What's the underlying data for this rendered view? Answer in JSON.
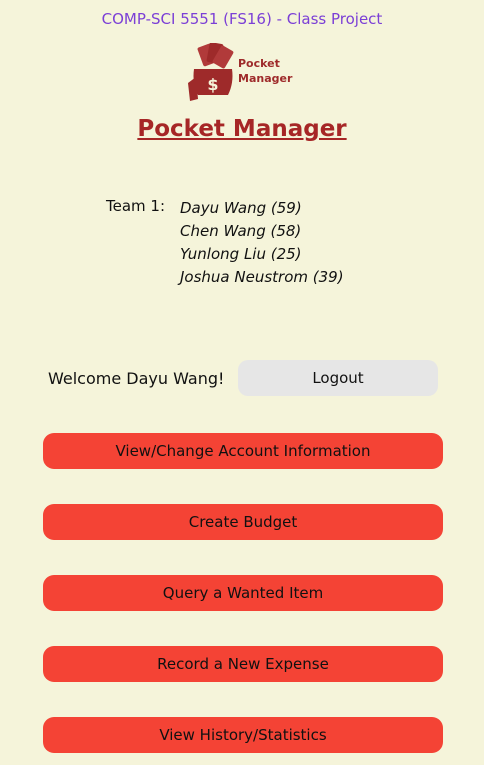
{
  "header": {
    "course": "COMP-SCI 5551 (FS16) - Class Project",
    "logo_line1": "Pocket",
    "logo_line2": "Manager",
    "app_title": "Pocket Manager"
  },
  "team": {
    "label": "Team 1:",
    "members": [
      "Dayu Wang (59)",
      "Chen Wang (58)",
      "Yunlong Liu (25)",
      "Joshua Neustrom (39)"
    ]
  },
  "session": {
    "welcome": "Welcome Dayu Wang!",
    "logout_label": "Logout"
  },
  "menu": [
    {
      "label": "View/Change Account Information"
    },
    {
      "label": "Create Budget"
    },
    {
      "label": "Query a Wanted Item"
    },
    {
      "label": "Record a New Expense"
    },
    {
      "label": "View History/Statistics"
    }
  ],
  "colors": {
    "background": "#f5f4da",
    "accent": "#f44335",
    "title": "#a62626",
    "course": "#7b3fd6"
  }
}
